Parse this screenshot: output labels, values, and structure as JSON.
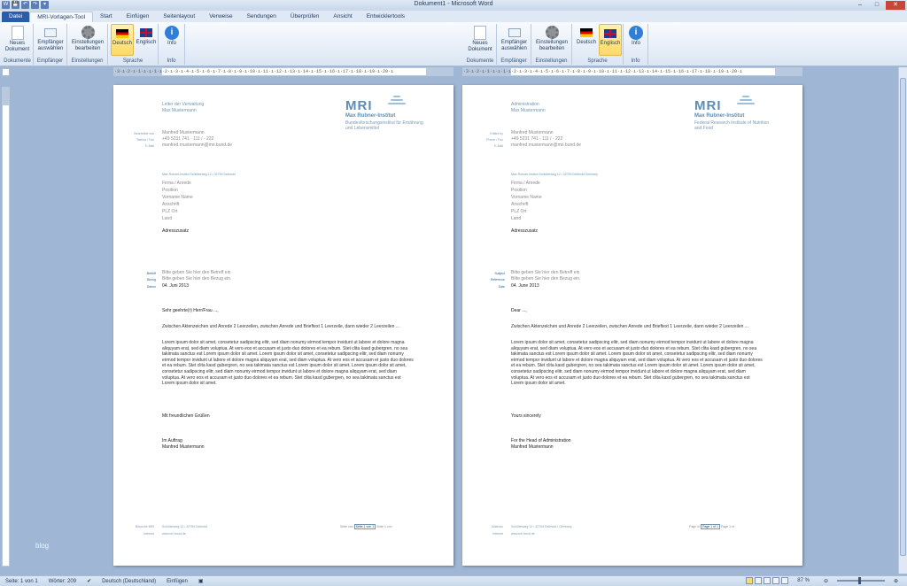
{
  "window": {
    "title": "Dokument1 - Microsoft Word"
  },
  "quick_access": [
    "W",
    "💾",
    "↶",
    "↷",
    "▾"
  ],
  "tabs": [
    "Datei",
    "MRI-Vorlagen-Tool",
    "Start",
    "Einfügen",
    "Seitenlayout",
    "Verweise",
    "Sendungen",
    "Überprüfen",
    "Ansicht",
    "Entwicklertools"
  ],
  "ribbon": {
    "left": {
      "btn_new": "Neues Dokument",
      "btn_recipient": "Empfänger auswählen",
      "btn_settings": "Einstellungen bearbeiten",
      "btn_de": "Deutsch",
      "btn_en": "Englisch",
      "btn_info": "Info",
      "groups": [
        "Dokumente",
        "Empfänger",
        "Einstellungen",
        "Sprache",
        "Info"
      ]
    },
    "right": {
      "btn_new": "Neues Dokument",
      "btn_recipient": "Empfänger auswählen",
      "btn_settings": "Einstellungen bearbeiten",
      "btn_de": "Deutsch",
      "btn_en": "Englisch",
      "btn_info": "Info",
      "groups": [
        "Dokumente",
        "Empfänger",
        "Einstellungen",
        "Sprache",
        "Info"
      ]
    }
  },
  "ruler": {
    "numbers": "·3·ı·2·ı·1·ı·ı·1·ı·2·ı·3·ı·4·ı·5·ı·6·ı·7·ı·8·ı·9·ı·10·ı·11·ı·12·ı·13·ı·14·ı·15·ı·16·ı·17·ı·18·ı·19·ı·20·ı"
  },
  "letter_de": {
    "sender_title": "Leiter der Verwaltung",
    "sender_name": "Max Mustermann",
    "logo": "MRI",
    "institute": "Max Rubner-Institut",
    "tagline": "Bundesforschungsinstitut für Ernährung und Lebensmittel",
    "contact_labels": [
      "Bearbeitet von",
      "Telefon / Fax",
      "E-Mail"
    ],
    "contact_name": "Manfred Mustermann",
    "contact_phone": "+49 5231 741 - 111 / - 222",
    "contact_email": "manfred.mustermann@mri.bund.de",
    "return_address": "Max Rubner-Institut Schlüterweg 12 • 32759 Detmold",
    "recipient": [
      "Firma / Anrede",
      "Position",
      "Vorname Name",
      "Anschrift",
      "PLZ Ort",
      "Land"
    ],
    "address_extra": "Adresszusatz",
    "meta_labels": [
      "Betreff",
      "Bezug",
      "Datum"
    ],
    "subject": "Bitte geben Sie hier den Betreff ein",
    "reference": "Bitte geben Sie hier den Bezug ein.",
    "date": "04. Juni 2013",
    "salutation": "Sehr geehrte(r) Herr/Frau ...,",
    "intro": "Zwischen Aktenzeichen und Anrede 2 Leerzeilen, zwischen Anrede und Brieftext 1 Leerzeile, dann wieder 2 Leerzeilen ...",
    "lorem": "Lorem ipsum dolor sit amet, consetetur sadipscing elitr, sed diam nonumy eirmod tempor invidunt ut labore et dolore magna aliquyam erat, sed diam voluptua. At vero eos et accusam et justo duo dolores et ea rebum. Stet clita kasd gubergren, no sea takimata sanctus est Lorem ipsum dolor sit amet. Lorem ipsum dolor sit amet, consetetur sadipscing elitr, sed diam nonumy eirmod tempor invidunt ut labore et dolore magna aliquyam erat, sed diam voluptua. At vero eos et accusam et justo duo dolores et ea rebum. Stet clita kasd gubergren, no sea takimata sanctus est Lorem ipsum dolor sit amet. Lorem ipsum dolor sit amet, consetetur sadipscing elitr, sed diam nonumy eirmod tempor invidunt ut labore et dolore magna aliquyam erat, sed diam voluptua. At vero eos et accusam et justo duo dolores et ea rebum. Stet clita kasd gubergren, no sea takimata sanctus est Lorem ipsum dolor sit amet.",
    "closing": "Mit freundlichen Grüßen",
    "signoff1": "Im Auftrag",
    "signoff2": "Manfred Mustermann",
    "footer_labels": [
      "Besuche MRI",
      "Internet"
    ],
    "footer_address": "Schlüterweg 12 • 32759 Detmold",
    "footer_web": "www.mri.bund.de",
    "page_prefix": "Seite von",
    "page_box": "Seite 1 von 1",
    "page_suffix": "Seite 1 von"
  },
  "letter_en": {
    "sender_title": "Administration",
    "sender_name": "Max Mustermann",
    "logo": "MRI",
    "institute": "Max Rubner-Institut",
    "tagline": "Federal Research Institute of Nutrition and Food",
    "contact_labels": [
      "Edited by",
      "Phone / Fax",
      "E-Mail"
    ],
    "contact_name": "Manfred Mustermann",
    "contact_phone": "+49 5231 741 - 111 / - 222",
    "contact_email": "manfred.mustermann@mri.bund.de",
    "return_address": "Max Rubner-Institut Schlüterweg 12 • 32759 Detmold Germany",
    "recipient": [
      "Firma / Anrede",
      "Position",
      "Vorname Name",
      "Anschrift",
      "PLZ Ort",
      "Land"
    ],
    "address_extra": "Adresszusatz",
    "meta_labels": [
      "Subject",
      "Reference",
      "Date"
    ],
    "subject": "Bitte geben Sie hier den Betreff ein",
    "reference": "Bitte geben Sie hier den Bezug ein.",
    "date": "04. June 2013",
    "salutation": "Dear ...,",
    "intro": "Zwischen Aktenzeichen und Anrede 2 Leerzeilen, zwischen Anrede und Brieftext 1 Leerzeile, dann wieder 2 Leerzeilen ...",
    "lorem": "Lorem ipsum dolor sit amet, consetetur sadipscing elitr, sed diam nonumy eirmod tempor invidunt ut labore et dolore magna aliquyam erat, sed diam voluptua. At vero eos et accusam et justo duo dolores et ea rebum. Stet clita kasd gubergren, no sea takimata sanctus est Lorem ipsum dolor sit amet. Lorem ipsum dolor sit amet, consetetur sadipscing elitr, sed diam nonumy eirmod tempor invidunt ut labore et dolore magna aliquyam erat, sed diam voluptua. At vero eos et accusam et justo duo dolores et ea rebum. Stet clita kasd gubergren, no sea takimata sanctus est Lorem ipsum dolor sit amet. Lorem ipsum dolor sit amet, consetetur sadipscing elitr, sed diam nonumy eirmod tempor invidunt ut labore et dolore magna aliquyam erat, sed diam voluptua. At vero eos et accusam et justo duo dolores et ea rebum. Stet clita kasd gubergren, no sea takimata sanctus est Lorem ipsum dolor sit amet.",
    "closing": "Yours sincerely",
    "signoff1": "For the Head of Administration",
    "signoff2": "Manfred Mustermann",
    "footer_labels": [
      "Address",
      "Internet"
    ],
    "footer_address": "Schlüterweg 12 • 32759 Detmold • Germany",
    "footer_web": "www.mri.bund.de",
    "page_prefix": "Page of",
    "page_box": "Page 1 of 1",
    "page_suffix": "Page 1 of"
  },
  "watermark": "blog",
  "statusbar": {
    "page": "Seite: 1 von 1",
    "words": "Wörter: 209",
    "language": "Deutsch (Deutschland)",
    "mode": "Einfügen",
    "zoom": "87 %"
  }
}
